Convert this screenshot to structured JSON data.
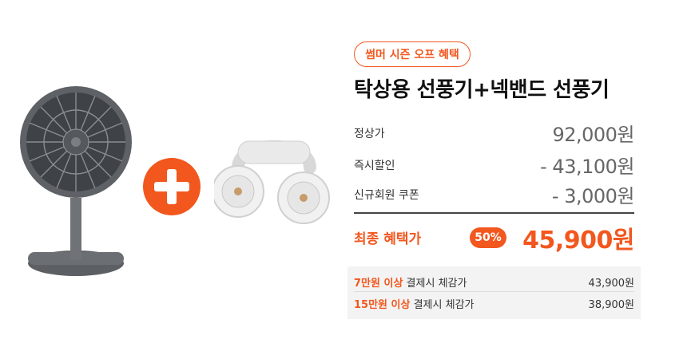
{
  "badge": "썸머 시즌 오프 혜택",
  "title": "탁상용 선풍기+넥밴드 선풍기",
  "rows": [
    {
      "label": "정상가",
      "value": "92,000원"
    },
    {
      "label": "즉시할인",
      "value": "- 43,100원"
    },
    {
      "label": "신규회원 쿠폰",
      "value": "- 3,000원"
    }
  ],
  "final": {
    "label": "최종 혜택가",
    "discount": "50%",
    "price": "45,900원"
  },
  "benefits": [
    {
      "highlight": "7만원 이상",
      "text": " 결제시 체감가",
      "price": "43,900원"
    },
    {
      "highlight": "15만원 이상",
      "text": " 결제시 체감가",
      "price": "38,900원"
    }
  ],
  "colors": {
    "accent": "#f2571e"
  },
  "icons": [
    "desk-fan-icon",
    "plus-icon",
    "neckband-fan-icon"
  ]
}
